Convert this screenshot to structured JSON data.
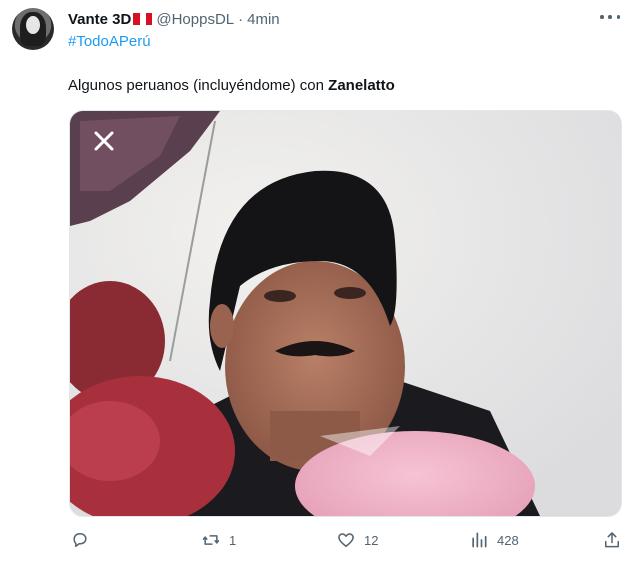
{
  "tweet": {
    "author_name": "Vante 3D",
    "handle": "@HoppsDL",
    "separator": "·",
    "time": "4min",
    "hashtag": "#TodoAPerú",
    "text_prefix": "Algunos peruanos (incluyéndome) con ",
    "text_bold": "Zanelatto"
  },
  "actions": {
    "reply": {
      "icon": "reply-icon",
      "count": ""
    },
    "retweet": {
      "icon": "retweet-icon",
      "count": "1"
    },
    "like": {
      "icon": "heart-icon",
      "count": "12"
    },
    "views": {
      "icon": "views-icon",
      "count": "428"
    },
    "share": {
      "icon": "share-icon",
      "count": ""
    }
  },
  "colors": {
    "text": "#0f1419",
    "secondary": "#536471",
    "link": "#1d9bf0",
    "flag_red": "#d91023"
  }
}
